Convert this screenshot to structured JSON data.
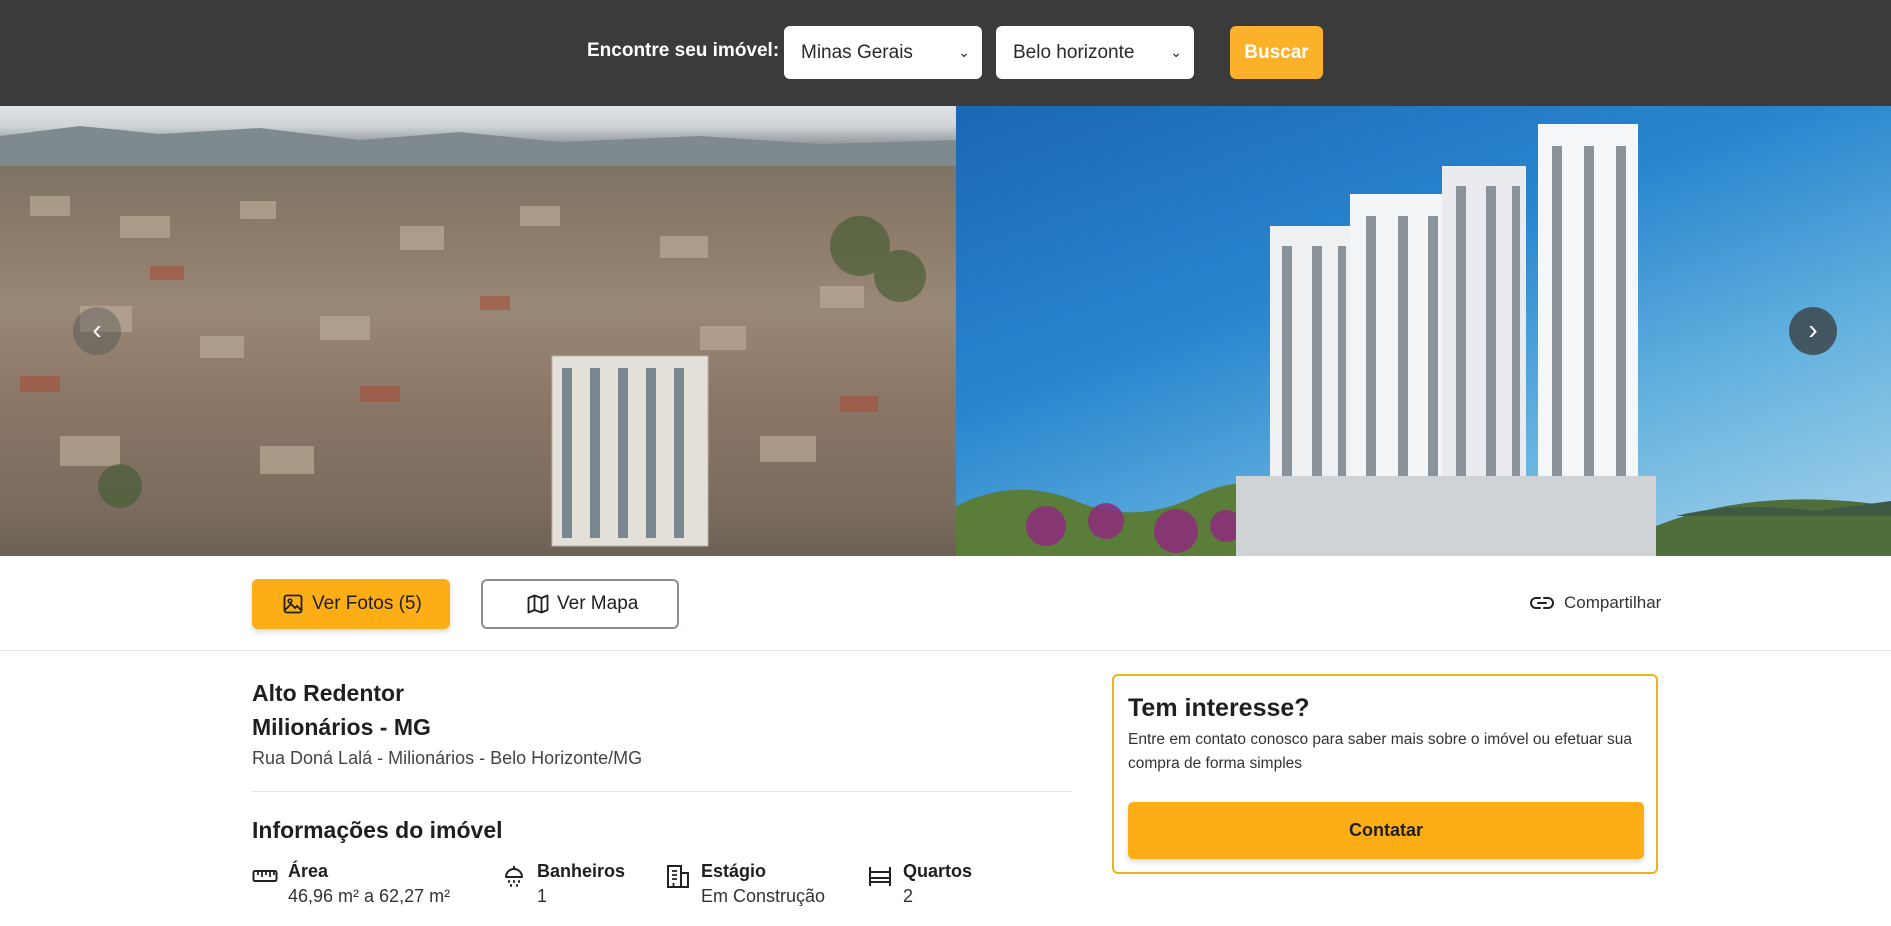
{
  "header": {
    "find_label": "Encontre seu imóvel:",
    "state_select": {
      "selected": "Minas Gerais"
    },
    "city_select": {
      "selected": "Belo horizonte"
    },
    "search_button": "Buscar",
    "select_chevron": "⌄"
  },
  "gallery": {
    "images": [
      {
        "icon": "aerial-city-photo"
      },
      {
        "icon": "building-render-photo"
      }
    ],
    "prev_arrow": "‹",
    "next_arrow": "›"
  },
  "actions": {
    "photos_button": "Ver Fotos (5)",
    "map_button": "Ver Mapa",
    "share_link": "Compartilhar"
  },
  "property": {
    "name_line1": "Alto Redentor",
    "name_line2": "Milionários - MG",
    "address": "Rua Doná Lalá - Milionários - Belo Horizonte/MG",
    "section_title": "Informações do imóvel",
    "specs": [
      {
        "icon": "ruler-icon",
        "label": "Área",
        "value": "46,96 m² a 62,27 m²"
      },
      {
        "icon": "shower-icon",
        "label": "Banheiros",
        "value": "1"
      },
      {
        "icon": "building-icon",
        "label": "Estágio",
        "value": "Em Construção"
      },
      {
        "icon": "bed-icon",
        "label": "Quartos",
        "value": "2"
      }
    ]
  },
  "interest_card": {
    "title": "Tem interesse?",
    "description": "Entre em contato conosco para saber mais sobre o imóvel ou efetuar sua compra de forma simples",
    "contact_button": "Contatar"
  },
  "colors": {
    "header_bg": "#3b3b3b",
    "accent": "#fdae16",
    "card_border": "#f2b318"
  }
}
